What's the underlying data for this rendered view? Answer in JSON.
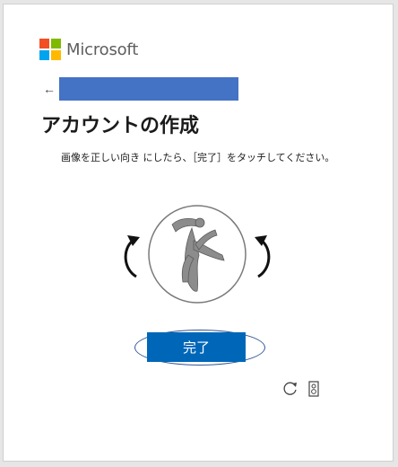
{
  "brand": {
    "name": "Microsoft",
    "logo_colors": [
      "#f25022",
      "#7fba00",
      "#00a4ef",
      "#ffb900"
    ]
  },
  "navigation": {
    "back_icon": "arrow-left-icon",
    "redaction_color": "#4472c4"
  },
  "heading": {
    "title": "アカウントの作成",
    "instruction": "画像を正しい向き にしたら、［完了］をタッチしてください。"
  },
  "challenge": {
    "rotate_left_icon": "rotate-left-icon",
    "rotate_right_icon": "rotate-right-icon",
    "image_icon": "dancer-figure-icon"
  },
  "actions": {
    "done_label": "完了",
    "done_color": "#0067b8"
  },
  "utilities": {
    "refresh_icon": "refresh-icon",
    "audio_icon": "audio-icon"
  }
}
